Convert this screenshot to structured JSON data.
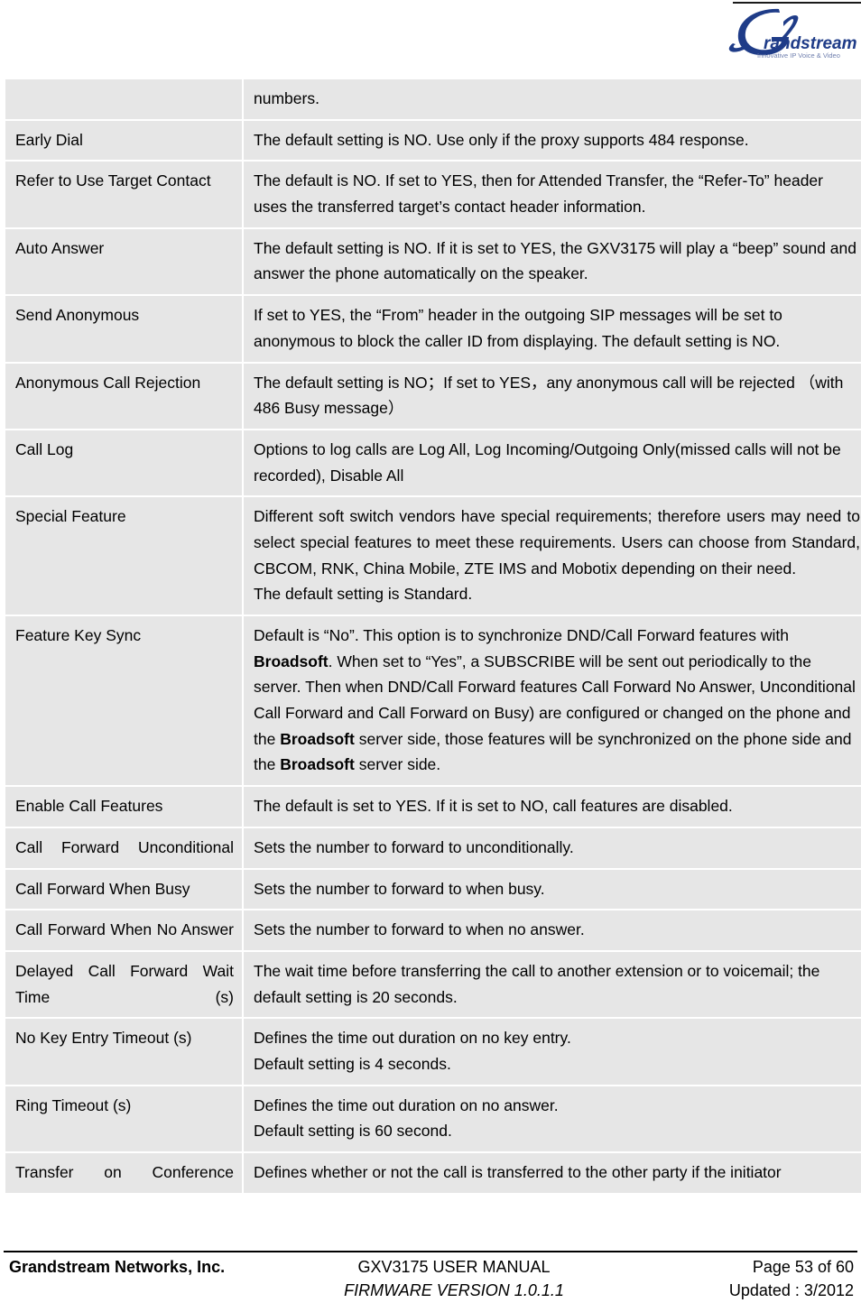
{
  "header": {
    "logo_name": "grandstream-logo",
    "logo_word": "randstream",
    "logo_tagline": "Innovative IP Voice & Video",
    "logo_color": "#1F3C88",
    "rule_color": "#1a1a1a"
  },
  "table": {
    "rows": [
      {
        "key": "",
        "key_justified": false,
        "value_justified": false,
        "paragraphs": [
          "numbers."
        ]
      },
      {
        "key": "Early Dial",
        "key_justified": false,
        "value_justified": false,
        "paragraphs": [
          "The default setting is NO. Use only if the proxy supports 484 response."
        ]
      },
      {
        "key": "Refer to Use Target Contact",
        "key_justified": false,
        "value_justified": false,
        "paragraphs": [
          "The default is NO. If set to YES, then for Attended Transfer, the “Refer-To” header uses the transferred target’s contact header information."
        ]
      },
      {
        "key": "Auto Answer",
        "key_justified": false,
        "value_justified": false,
        "paragraphs": [
          "The default setting is NO. If it is set to YES, the GXV3175 will play a “beep” sound and answer the phone automatically on the speaker."
        ]
      },
      {
        "key": "Send Anonymous",
        "key_justified": false,
        "value_justified": false,
        "paragraphs": [
          "If set to YES, the “From” header in the outgoing SIP messages will be set to anonymous to block the caller ID from displaying. The default setting is NO."
        ]
      },
      {
        "key": "Anonymous Call Rejection",
        "key_justified": false,
        "value_justified": false,
        "paragraphs": [
          "The default setting is NO；If set to YES，any anonymous call will be rejected （with 486 Busy message）"
        ]
      },
      {
        "key": "Call Log",
        "key_justified": false,
        "value_justified": true,
        "paragraphs": [
          "Options to log calls are Log All, Log Incoming/Outgoing Only(missed calls will not be recorded), Disable All"
        ]
      },
      {
        "key": "Special Feature",
        "key_justified": false,
        "value_justified": true,
        "paragraphs": [
          "Different soft switch vendors have special requirements; therefore users may need to select special features to meet these requirements. Users can choose from Standard, CBCOM, RNK, China Mobile, ZTE IMS and Mobotix depending on their need.",
          "The default setting is Standard."
        ]
      },
      {
        "key": "Feature Key Sync",
        "key_justified": false,
        "value_justified": true,
        "rich": true,
        "paragraphs": [
          "Default is “No”. This option is to synchronize DND/Call Forward features with Broadsoft. When set to “Yes”, a SUBSCRIBE will be sent out periodically to the server. Then when DND/Call Forward features Call Forward No Answer, Unconditional Call Forward and Call Forward on Busy) are configured or changed on the phone and the Broadsoft server side, those features will be synchronized on the phone side and the Broadsoft server side."
        ],
        "bold_terms": [
          "Broadsoft"
        ]
      },
      {
        "key": "Enable Call Features",
        "key_justified": false,
        "value_justified": false,
        "paragraphs": [
          "The default is set to YES. If it is set to NO, call features are disabled."
        ]
      },
      {
        "key": "Call Forward Unconditional",
        "key_justified": true,
        "value_justified": false,
        "paragraphs": [
          "Sets the number to forward to unconditionally."
        ]
      },
      {
        "key": "Call Forward When Busy",
        "key_justified": false,
        "value_justified": false,
        "paragraphs": [
          "Sets the number to forward to when busy."
        ]
      },
      {
        "key": "Call Forward When No Answer",
        "key_justified": true,
        "value_justified": false,
        "paragraphs": [
          "Sets the number to forward to when no answer."
        ]
      },
      {
        "key": "Delayed Call Forward Wait Time (s)",
        "key_justified": true,
        "value_justified": true,
        "paragraphs": [
          "The wait time before transferring the call to another extension or to voicemail; the default setting is 20 seconds."
        ]
      },
      {
        "key": "No Key Entry Timeout (s)",
        "key_justified": false,
        "value_justified": false,
        "paragraphs": [
          "Defines the time out duration on no key entry.",
          "Default setting is 4 seconds."
        ]
      },
      {
        "key": "Ring Timeout (s)",
        "key_justified": false,
        "value_justified": false,
        "paragraphs": [
          "Defines the time out duration on no answer.",
          "Default setting is 60 second."
        ]
      },
      {
        "key": "Transfer on Conference",
        "key_justified": true,
        "value_justified": false,
        "paragraphs": [
          "Defines whether or not the call is transferred to the other party if the initiator"
        ]
      }
    ]
  },
  "footer": {
    "company": "Grandstream Networks, Inc.",
    "manual_title": "GXV3175 USER MANUAL",
    "firmware": "FIRMWARE VERSION 1.0.1.1",
    "page": "Page 53 of 60",
    "updated": "Updated : 3/2012"
  }
}
